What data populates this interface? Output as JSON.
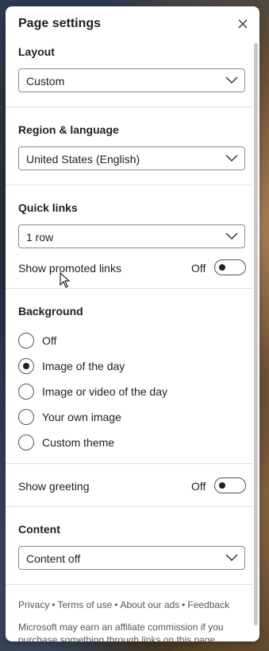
{
  "panel": {
    "title": "Page settings"
  },
  "layout": {
    "label": "Layout",
    "value": "Custom"
  },
  "region": {
    "label": "Region & language",
    "value": "United States (English)"
  },
  "quick_links": {
    "label": "Quick links",
    "value": "1 row",
    "promoted_label": "Show promoted links",
    "promoted_state": "Off"
  },
  "background": {
    "label": "Background",
    "options": [
      {
        "label": "Off",
        "checked": false
      },
      {
        "label": "Image of the day",
        "checked": true
      },
      {
        "label": "Image or video of the day",
        "checked": false
      },
      {
        "label": "Your own image",
        "checked": false
      },
      {
        "label": "Custom theme",
        "checked": false
      }
    ]
  },
  "greeting": {
    "label": "Show greeting",
    "state": "Off"
  },
  "content": {
    "label": "Content",
    "value": "Content off"
  },
  "footer": {
    "links": [
      "Privacy",
      "Terms of use",
      "About our ads",
      "Feedback"
    ],
    "separator": "•",
    "disclaimer": "Microsoft may earn an affiliate commission if you purchase something through links on this page."
  },
  "icons": {
    "close": "close-icon",
    "chevron": "chevron-down-icon",
    "cursor": "mouse-pointer-icon"
  }
}
